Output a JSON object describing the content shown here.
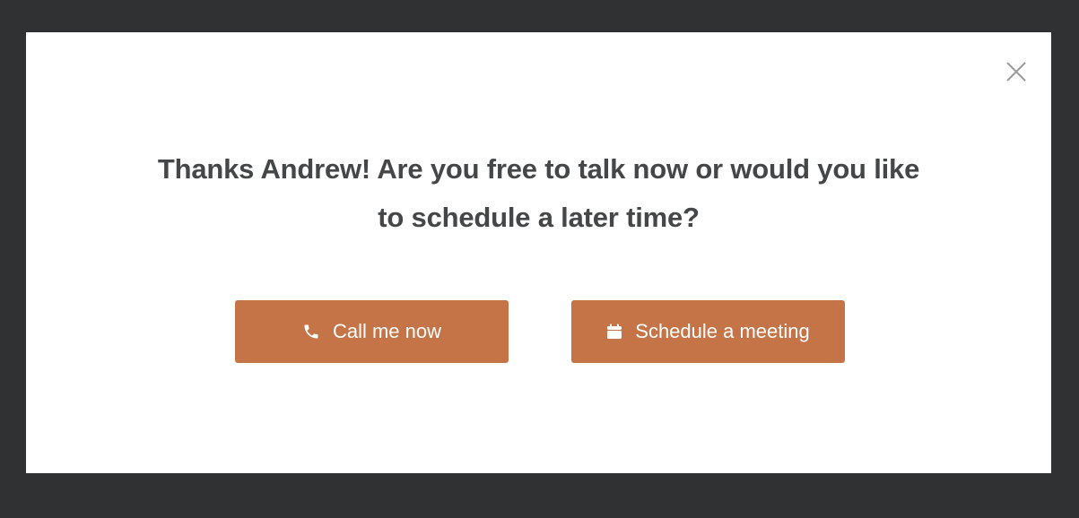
{
  "modal": {
    "heading": "Thanks Andrew! Are you free to talk now or would you like to schedule a later time?",
    "close_icon": "close-icon",
    "buttons": [
      {
        "label": "Call me now",
        "icon": "phone-icon"
      },
      {
        "label": "Schedule a meeting",
        "icon": "calendar-icon"
      }
    ]
  },
  "colors": {
    "backdrop": "#303133",
    "modal_background": "#ffffff",
    "heading_text": "#454647",
    "button_background": "#c47446",
    "button_text": "#ffffff",
    "close_icon": "#9a9b9c"
  }
}
